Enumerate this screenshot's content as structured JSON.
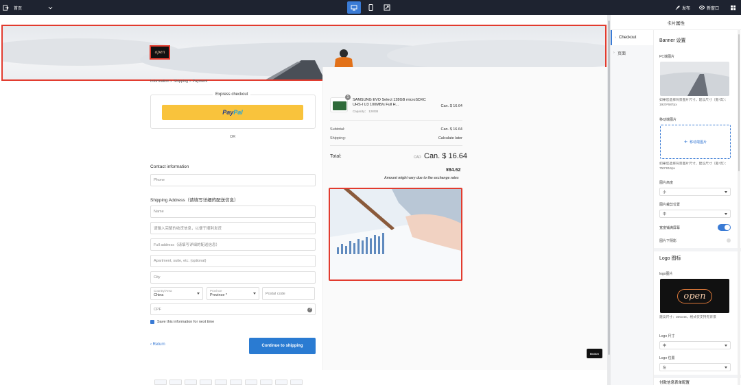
{
  "topbar": {
    "page_select": "首页",
    "publish_label": "发布",
    "preview_label": "新窗口",
    "devices": [
      "desktop-icon",
      "mobile-icon",
      "fullscreen-icon"
    ]
  },
  "checkout": {
    "breadcrumb": "Information  >  Shipping  >  Payment",
    "express_title": "Express checkout",
    "paypal_pay": "Pay",
    "paypal_pal": "Pal",
    "or_text": "OR",
    "contact_label": "Contact information",
    "phone_placeholder": "Phone",
    "shipping_label": "Shipping Address（请填写详细的配送信息）",
    "fields": {
      "name": "Name",
      "detail": "请输入完整的收货信息，以便于顺利发货",
      "full_address": "Full address（请填写详细的配送信息）",
      "apartment": "Apartment, suite, etc. (optional)",
      "city": "City",
      "country_label": "Country/Area",
      "country_value": "China",
      "province_label": "Province",
      "province_value": "Province *",
      "postal": "Postal code",
      "cpf": "CPF"
    },
    "save_info": "Save this information for next time",
    "return_label": "Return",
    "continue_label": "Continue to shipping"
  },
  "summary": {
    "product_qty": "1",
    "product_name": "SAMSUNG EVO Select 128GB microSDXC UHS-I U3 100MB/s Full H...",
    "product_capacity": "Capacity： 128GB",
    "product_price": "Can. $ 16.64",
    "subtotal_label": "Subtotal:",
    "subtotal_value": "Can. $ 16.64",
    "shipping_label": "Shipping:",
    "shipping_value": "Calculate later",
    "total_label": "Total:",
    "total_currency": "CAD",
    "total_value": "Can. $ 16.64",
    "total_jpy": "¥84.62",
    "exchange_note": "Amount might vary due to the exchange rates"
  },
  "floating_button": "Button",
  "right_panel": {
    "title": "卡片属性",
    "tabs": [
      "Checkout",
      "页面"
    ],
    "banner_heading": "Banner 设置",
    "pc_image_label": "PC端图片",
    "pc_note": "如果您选择背景图片尺寸，建议尺寸（宽*高）：1920*687px",
    "mobile_image_label": "移动端图片",
    "mobile_upload": "移动端图片",
    "mobile_note": "如果您选择背景图片尺寸，建议尺寸（宽*高）：750*816px",
    "height_label": "图片高度",
    "height_value": "小",
    "crop_label": "图片裁剪位置",
    "crop_value": "中",
    "fullscreen_label": "宽度铺满屏幕",
    "bottom_shadow_label": "图片下阴影",
    "logo_heading": "Logo 图标",
    "logo_image_label": "logo图片",
    "logo_text": "open",
    "logo_note": "建议尺寸：300x48，格式仅支持无背景",
    "logo_size_label": "Logo 尺寸",
    "logo_size_value": "中",
    "logo_pos_label": "Logo 位置",
    "logo_pos_value": "左",
    "more_label": "付款信息表单配置"
  },
  "banner": {
    "logo_text": "open"
  },
  "colors": {
    "topbar": "#1e2330",
    "accent": "#3a7bd5",
    "selection": "#e23b2e",
    "paypal": "#f9c33c"
  }
}
